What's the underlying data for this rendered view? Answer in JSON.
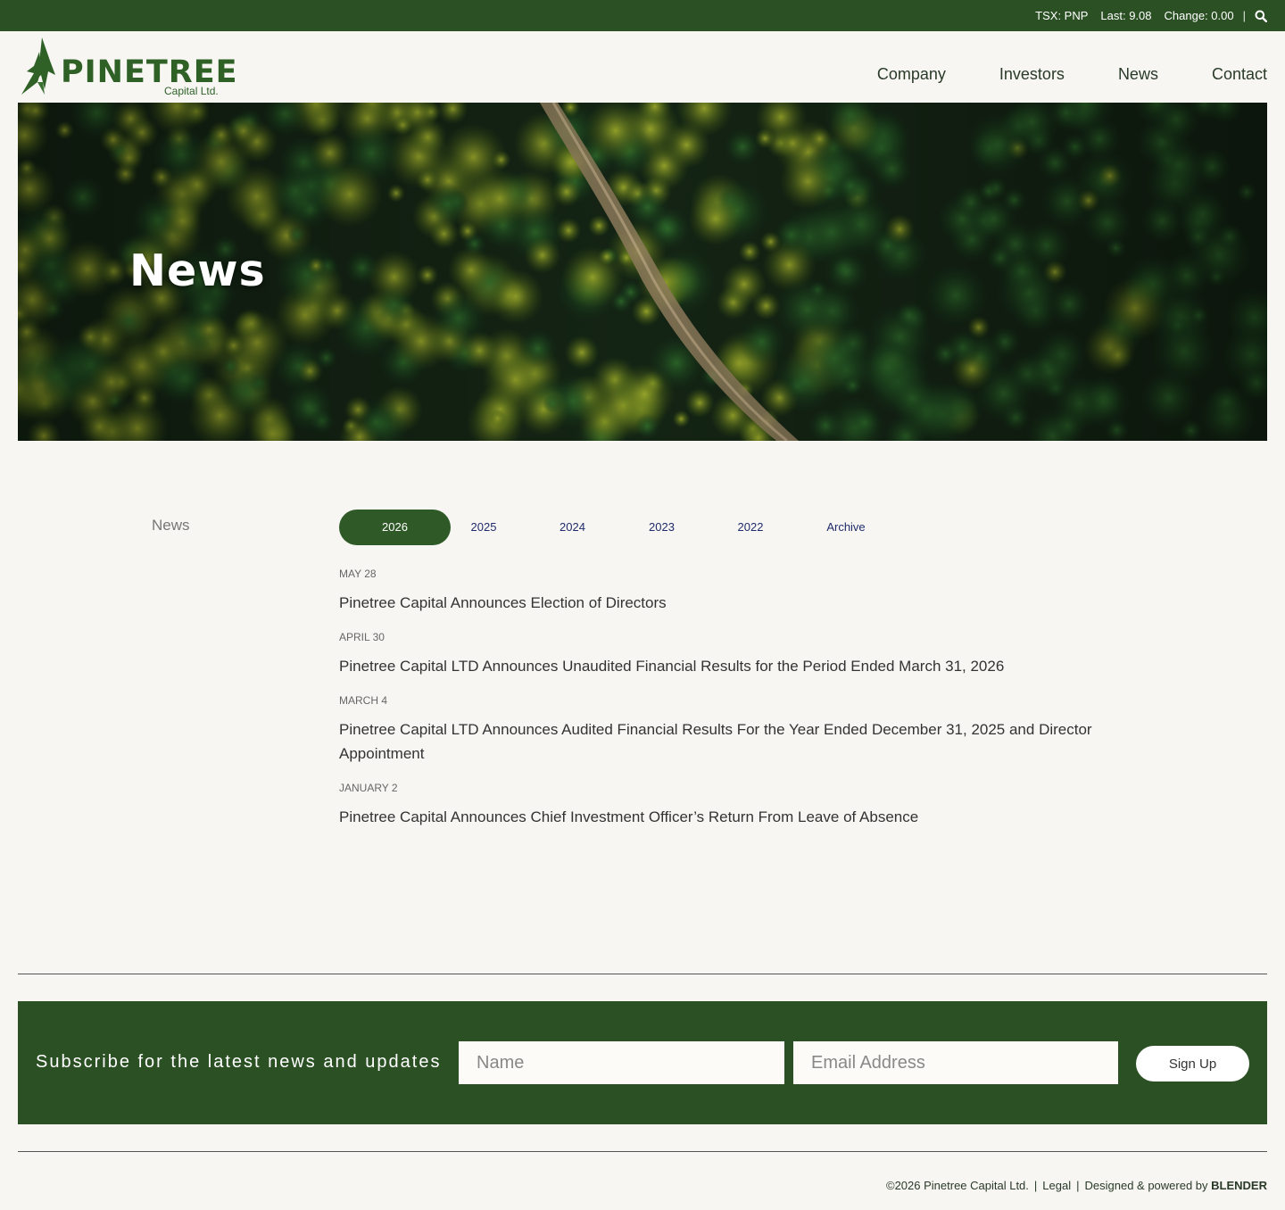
{
  "topbar": {
    "symbol": "TSX: PNP",
    "last": "Last: 9.08",
    "change": "Change: 0.00",
    "separator": "|",
    "search_icon": "search-icon"
  },
  "brand": {
    "name": "PINETREE",
    "sub": "Capital Ltd."
  },
  "nav": [
    "Company",
    "Investors",
    "News",
    "Contact"
  ],
  "hero": {
    "title": "News"
  },
  "sidebar": {
    "label": "News"
  },
  "year_tabs": [
    "2026",
    "2025",
    "2024",
    "2023",
    "2022",
    "Archive"
  ],
  "active_tab": "2026",
  "news_items": [
    {
      "date": "MAY 28",
      "title": "Pinetree Capital Announces Election of Directors"
    },
    {
      "date": "APRIL 30",
      "title": "Pinetree Capital LTD Announces Unaudited Financial Results for the Period Ended March 31, 2026"
    },
    {
      "date": "MARCH 4",
      "title": "Pinetree Capital LTD Announces Audited Financial Results For the Year Ended December 31, 2025 and Director Appointment"
    },
    {
      "date": "JANUARY 2",
      "title": "Pinetree Capital Announces Chief Investment Officer’s Return From Leave of Absence"
    }
  ],
  "subscribe": {
    "label": "Subscribe for the latest news and updates",
    "name_placeholder": "Name",
    "email_placeholder": "Email Address",
    "button": "Sign Up"
  },
  "footer": {
    "copyright": "©2026 Pinetree Capital Ltd.",
    "legal": "Legal",
    "designed": "Designed & powered by",
    "agency": "BLENDER"
  },
  "colors": {
    "brand_green": "#2a5024",
    "active_tab": "#2f5a28",
    "tab_text": "#1f2b6b"
  }
}
